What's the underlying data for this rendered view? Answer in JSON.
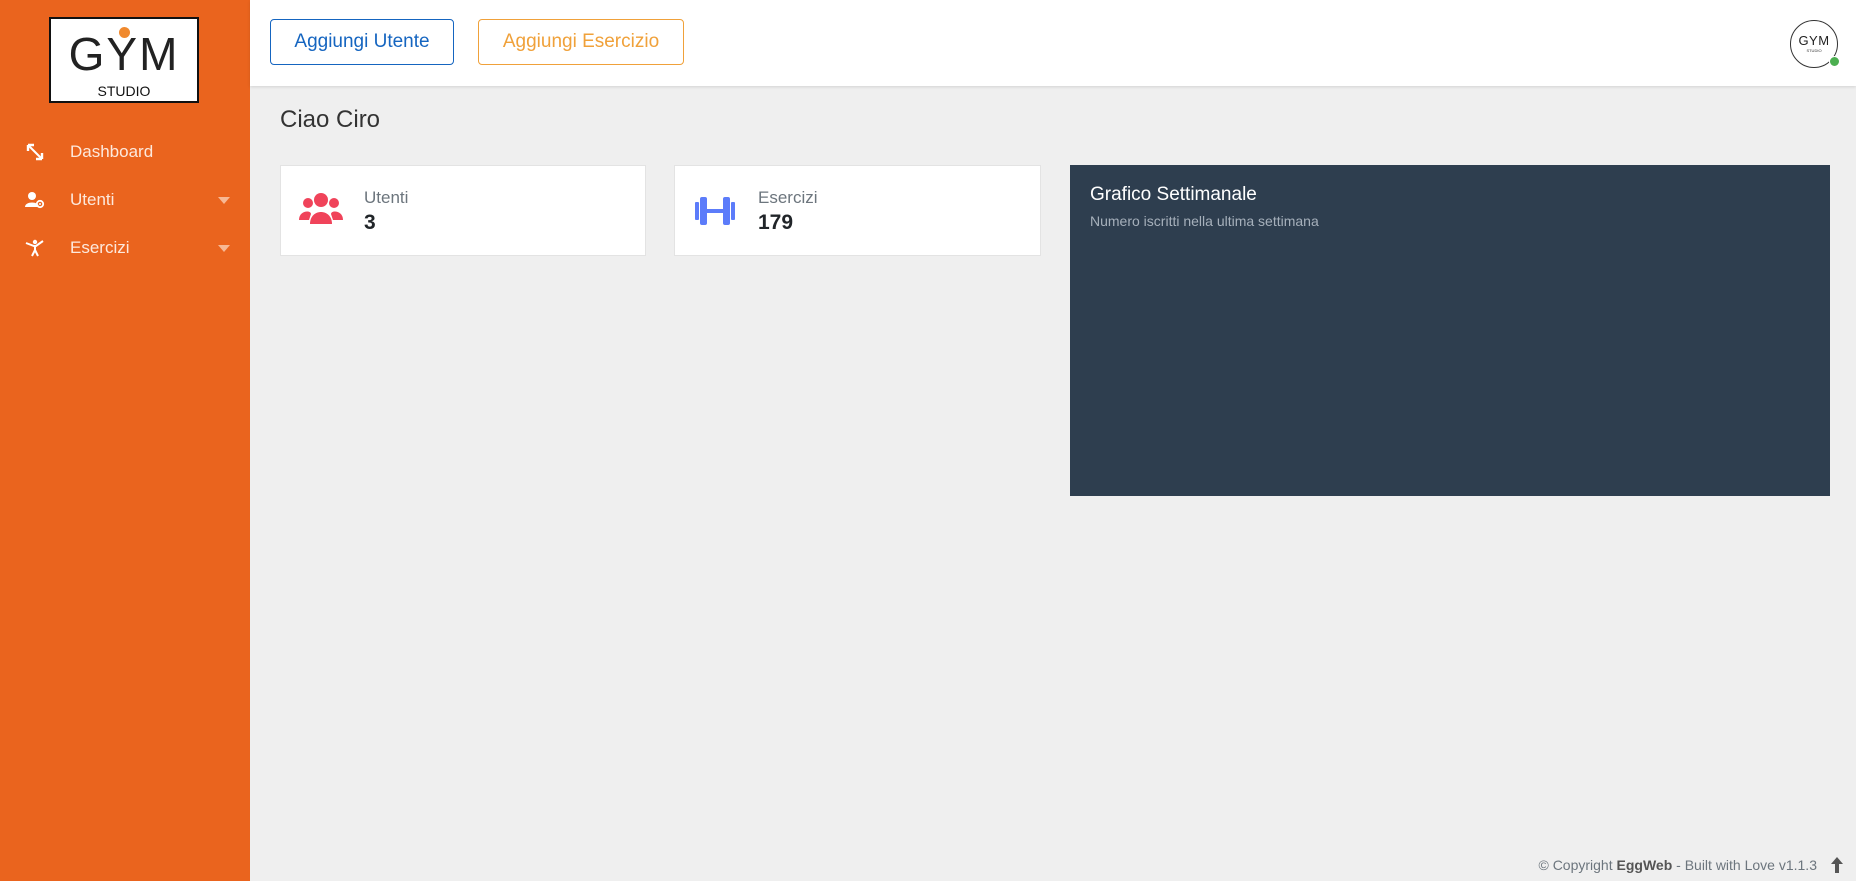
{
  "sidebar": {
    "logo": {
      "main": "GYM",
      "sub": "STUDIO"
    },
    "items": [
      {
        "label": "Dashboard",
        "icon": "expand-arrows-icon"
      },
      {
        "label": "Utenti",
        "icon": "user-cog-icon"
      },
      {
        "label": "Esercizi",
        "icon": "martial-arts-icon"
      }
    ]
  },
  "header": {
    "add_user_label": "Aggiungi Utente",
    "add_exercise_label": "Aggiungi Esercizio",
    "avatar": {
      "text": "GYM",
      "sub": "STUDIO"
    }
  },
  "main": {
    "greeting": "Ciao Ciro",
    "stats": [
      {
        "label": "Utenti",
        "value": "3",
        "icon": "users-icon",
        "color": "#f0435a"
      },
      {
        "label": "Esercizi",
        "value": "179",
        "icon": "dumbbell-icon",
        "color": "#5c7cfa"
      }
    ],
    "chart": {
      "title": "Grafico Settimanale",
      "subtitle": "Numero iscritti nella ultima settimana"
    }
  },
  "footer": {
    "prefix": "© Copyright ",
    "brand": "EggWeb",
    "suffix": " - Built with Love v1.1.3"
  },
  "colors": {
    "sidebar": "#ea641e",
    "primary": "#1565c0",
    "warning": "#f0a13a",
    "chart_bg": "#2e3e4f",
    "status_online": "#4caf50"
  }
}
